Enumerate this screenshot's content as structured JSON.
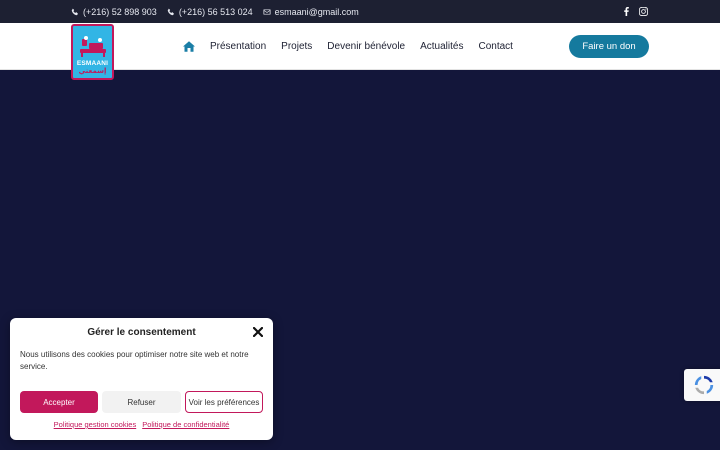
{
  "topbar": {
    "phone1": "(+216) 52 898 903",
    "phone2": "(+216) 56 513 024",
    "email": "esmaani@gmail.com",
    "icons": [
      "phone-icon",
      "phone-icon",
      "envelope-icon",
      "facebook-icon",
      "instagram-icon"
    ]
  },
  "header": {
    "logo_text": "ESMAANI",
    "logo_text_ar": "إسمعني",
    "nav": [
      "Présentation",
      "Projets",
      "Devenir bénévole",
      "Actualités",
      "Contact"
    ],
    "donate_label": "Faire un don"
  },
  "consent": {
    "title": "Gérer le consentement",
    "message": "Nous utilisons des cookies pour optimiser notre site web et notre service.",
    "accept_label": "Accepter",
    "refuse_label": "Refuser",
    "prefs_label": "Voir les préférences",
    "link_cookies": "Politique gestion cookies",
    "link_privacy": "Politique de confidentialité"
  },
  "colors": {
    "hero_bg": "#13163a",
    "topbar_bg": "#1d2032",
    "accent_blue": "#157a9e",
    "accent_pink": "#c2185b",
    "logo_bg": "#32b5e5"
  }
}
